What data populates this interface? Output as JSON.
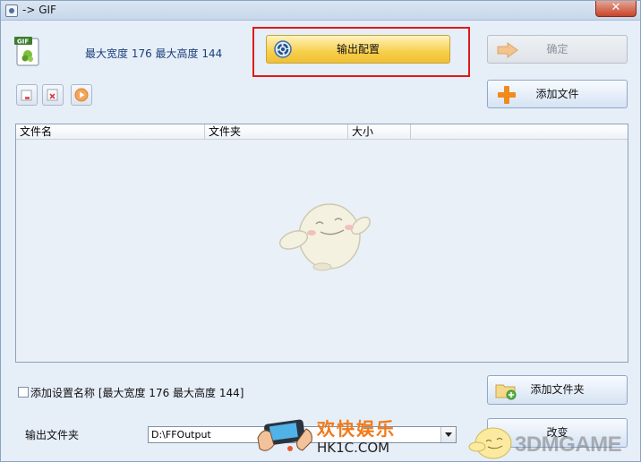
{
  "window": {
    "title": "-> GIF",
    "close_label": "✕"
  },
  "header": {
    "size_info": "最大宽度 176 最大高度 144",
    "output_config_label": "输出配置",
    "ok_label": "确定",
    "add_file_label": "添加文件"
  },
  "file_list": {
    "columns": [
      "文件名",
      "文件夹",
      "大小"
    ]
  },
  "bottom": {
    "preset_label": "添加设置名称 [最大宽度 176 最大高度 144]",
    "add_folder_label": "添加文件夹",
    "output_folder_label": "输出文件夹",
    "output_folder_value": "D:\\FFOutput",
    "change_label": "改变"
  },
  "watermarks": {
    "hk1c_title": "欢快娱乐",
    "hk1c_url": "HK1C.COM",
    "threedm": "3DMGAME"
  },
  "colors": {
    "highlight": "#e01a1a",
    "primary_button": "#f7cf4b",
    "accent_orange": "#f07a1a"
  }
}
